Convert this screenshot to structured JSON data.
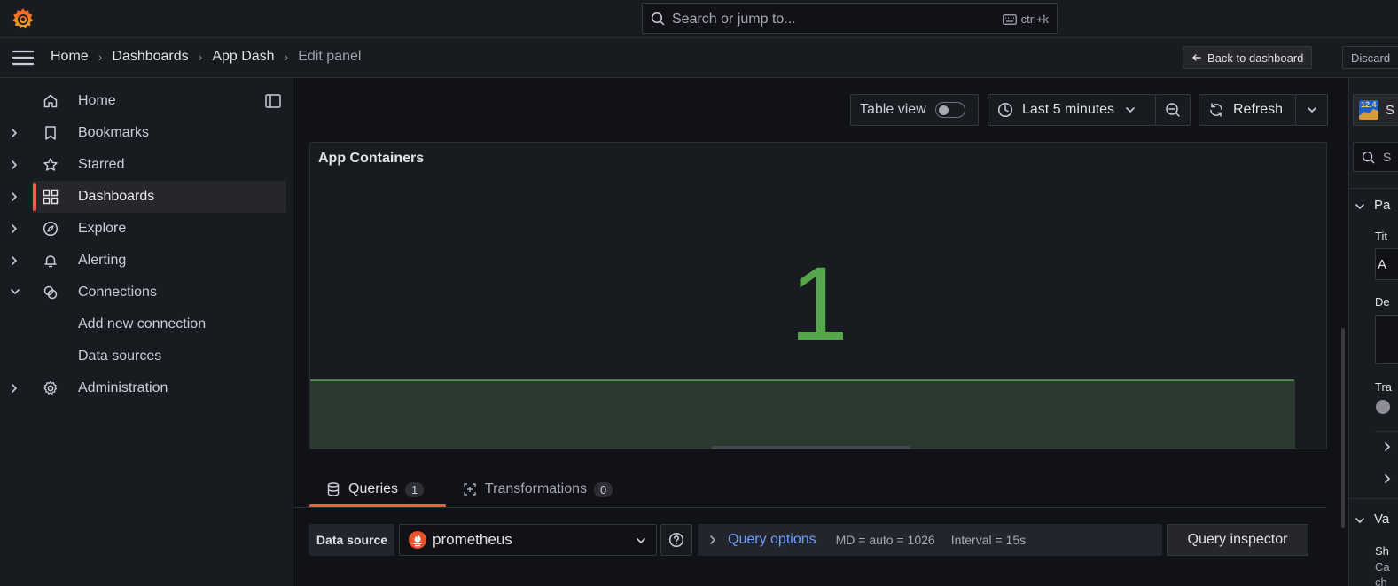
{
  "topbar": {
    "search_placeholder": "Search or jump to...",
    "search_shortcut": "ctrl+k"
  },
  "breadcrumb": {
    "items": [
      "Home",
      "Dashboards",
      "App Dash"
    ],
    "current": "Edit panel"
  },
  "actions": {
    "back_label": "Back to dashboard",
    "discard_label": "Discard"
  },
  "sidebar": {
    "items": [
      {
        "label": "Home",
        "icon": "home-icon"
      },
      {
        "label": "Bookmarks",
        "icon": "bookmark-icon"
      },
      {
        "label": "Starred",
        "icon": "star-icon"
      },
      {
        "label": "Dashboards",
        "icon": "dashboards-grid-icon",
        "active": true
      },
      {
        "label": "Explore",
        "icon": "compass-icon"
      },
      {
        "label": "Alerting",
        "icon": "bell-icon"
      },
      {
        "label": "Connections",
        "icon": "connections-icon",
        "expanded": true
      },
      {
        "label": "Add new connection",
        "sub": true
      },
      {
        "label": "Data sources",
        "sub": true
      },
      {
        "label": "Administration",
        "icon": "gear-icon"
      }
    ]
  },
  "toolbar": {
    "table_view_label": "Table view",
    "table_view_on": false,
    "time_range_label": "Last 5 minutes",
    "refresh_label": "Refresh"
  },
  "panel": {
    "title": "App Containers",
    "stat_value": "1",
    "color": "#56a64b"
  },
  "tabs": [
    {
      "label": "Queries",
      "count": "1"
    },
    {
      "label": "Transformations",
      "count": "0"
    }
  ],
  "query": {
    "datasource_label": "Data source",
    "datasource_value": "prometheus",
    "options_label": "Query options",
    "md_text": "MD = auto = 1026",
    "interval_text": "Interval = 15s",
    "inspector_label": "Query inspector"
  },
  "rpane": {
    "viz_badge": "12.4",
    "viz_label_partial": "S",
    "search_partial": "S",
    "section1": "Pa",
    "title_label": "Tit",
    "title_value": "A",
    "desc_label": "De",
    "transparent_label": "Tra",
    "section2": "Va",
    "sh_label": "Sh",
    "ca_label": "Ca",
    "ch_label": "ch"
  },
  "colors": {
    "accent": "#f55f3e",
    "link": "#6e9fff",
    "stat_green": "#56a64b"
  }
}
